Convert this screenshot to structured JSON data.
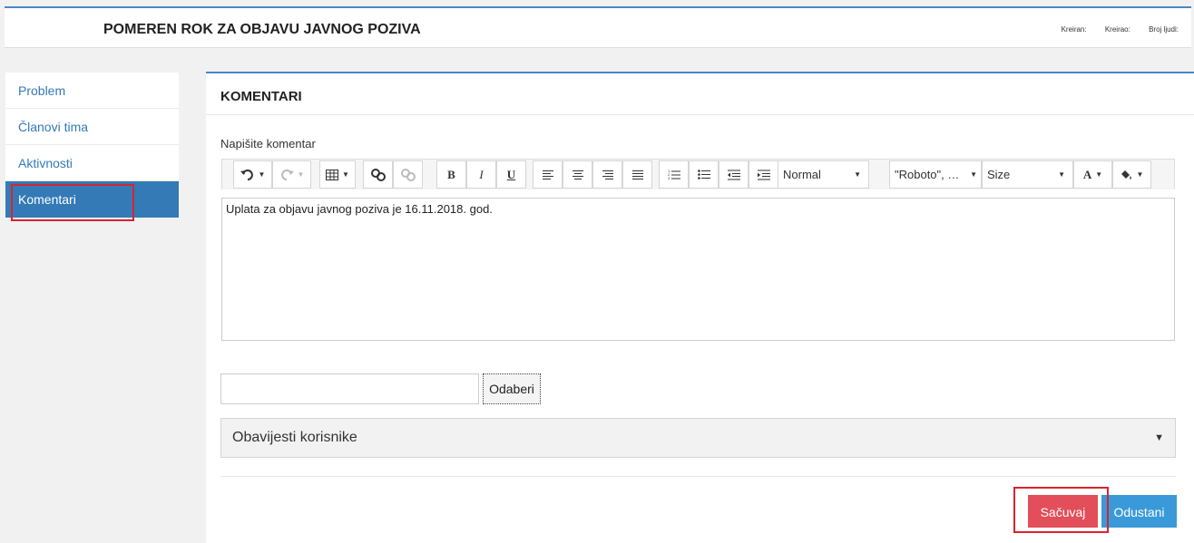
{
  "header": {
    "title": "POMEREN ROK ZA OBJAVU JAVNOG POZIVA",
    "meta": [
      "Kreiran:",
      "Kreirao:",
      "Broj ljudi:"
    ]
  },
  "sidebar": {
    "items": [
      {
        "label": "Problem"
      },
      {
        "label": "Članovi tima"
      },
      {
        "label": "Aktivnosti"
      },
      {
        "label": "Komentari",
        "active": true
      }
    ]
  },
  "panel": {
    "title": "KOMENTARI",
    "comment_label": "Napišite komentar",
    "editor_text": "Uplata za objavu javnog poziva je 16.11.2018. god."
  },
  "toolbar": {
    "bold": "B",
    "italic": "I",
    "underline": "U",
    "style_select": "Normal",
    "font_select": "\"Roboto\", …",
    "size_select": "Size",
    "color_letter": "A"
  },
  "file": {
    "button_label": "Odaberi"
  },
  "notify": {
    "label": "Obavijesti korisnike"
  },
  "actions": {
    "save_label": "Sačuvaj",
    "cancel_label": "Odustani"
  },
  "colors": {
    "accent": "#337ab7",
    "save": "#e24e5a",
    "cancel": "#3a9ad9",
    "highlight": "#d9232e"
  }
}
